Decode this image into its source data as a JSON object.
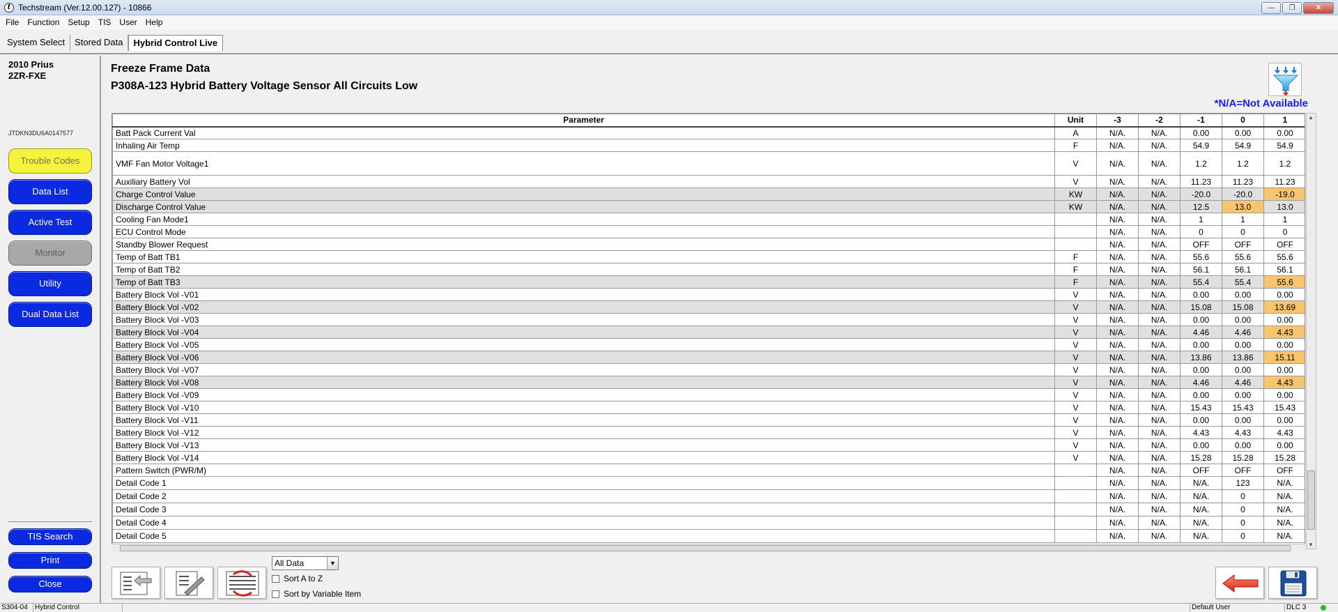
{
  "window": {
    "title": "Techstream (Ver.12.00.127) - 10866",
    "app_icon": "t",
    "minimize": "—",
    "maximize": "❐",
    "close": "✕"
  },
  "menu": [
    "File",
    "Function",
    "Setup",
    "TIS",
    "User",
    "Help"
  ],
  "tabs": [
    "System Select",
    "Stored Data",
    "Hybrid Control Live"
  ],
  "left_panel": {
    "vehicle_line1": "2010 Prius",
    "vehicle_line2": "2ZR-FXE",
    "vin": "JTDKN3DU6A0147577",
    "buttons": [
      "Trouble Codes",
      "Data List",
      "Active Test",
      "Monitor",
      "Utility",
      "Dual Data List"
    ],
    "bottom_buttons": [
      "TIS Search",
      "Print",
      "Close"
    ]
  },
  "main": {
    "title": "Freeze Frame Data",
    "dtc": "P308A-123 Hybrid Battery Voltage Sensor All Circuits Low",
    "na_note": "*N/A=Not Available"
  },
  "table": {
    "headers": [
      "Parameter",
      "Unit",
      "-3",
      "-2",
      "-1",
      "0",
      "1"
    ],
    "rows": [
      {
        "p": "Batt Pack Current Val",
        "u": "A",
        "v": [
          "N/A.",
          "N/A.",
          "0.00",
          "0.00",
          "0.00"
        ],
        "h": []
      },
      {
        "p": "Inhaling Air Temp",
        "u": "F",
        "v": [
          "N/A.",
          "N/A.",
          "54.9",
          "54.9",
          "54.9"
        ],
        "h": []
      },
      {
        "p": "VMF Fan Motor Voltage1",
        "u": "V",
        "v": [
          "N/A.",
          "N/A.",
          "1.2",
          "1.2",
          "1.2"
        ],
        "h": [],
        "tall": true
      },
      {
        "p": "Auxiliary Battery Vol",
        "u": "V",
        "v": [
          "N/A.",
          "N/A.",
          "11.23",
          "11.23",
          "11.23"
        ],
        "h": []
      },
      {
        "p": "Charge Control Value",
        "u": "KW",
        "v": [
          "N/A.",
          "N/A.",
          "-20.0",
          "-20.0",
          "-19.0"
        ],
        "h": [
          4
        ],
        "shaded": true
      },
      {
        "p": "Discharge Control Value",
        "u": "KW",
        "v": [
          "N/A.",
          "N/A.",
          "12.5",
          "13.0",
          "13.0"
        ],
        "h": [
          3
        ],
        "shaded": true
      },
      {
        "p": "Cooling Fan Mode1",
        "u": "",
        "v": [
          "N/A.",
          "N/A.",
          "1",
          "1",
          "1"
        ],
        "h": []
      },
      {
        "p": "ECU Control Mode",
        "u": "",
        "v": [
          "N/A.",
          "N/A.",
          "0",
          "0",
          "0"
        ],
        "h": []
      },
      {
        "p": "Standby Blower Request",
        "u": "",
        "v": [
          "N/A.",
          "N/A.",
          "OFF",
          "OFF",
          "OFF"
        ],
        "h": []
      },
      {
        "p": "Temp of Batt TB1",
        "u": "F",
        "v": [
          "N/A.",
          "N/A.",
          "55.6",
          "55.6",
          "55.6"
        ],
        "h": []
      },
      {
        "p": "Temp of Batt TB2",
        "u": "F",
        "v": [
          "N/A.",
          "N/A.",
          "56.1",
          "56.1",
          "56.1"
        ],
        "h": []
      },
      {
        "p": "Temp of Batt TB3",
        "u": "F",
        "v": [
          "N/A.",
          "N/A.",
          "55.4",
          "55.4",
          "55.6"
        ],
        "h": [
          4
        ],
        "shaded": true
      },
      {
        "p": "Battery Block Vol -V01",
        "u": "V",
        "v": [
          "N/A.",
          "N/A.",
          "0.00",
          "0.00",
          "0.00"
        ],
        "h": []
      },
      {
        "p": "Battery Block Vol -V02",
        "u": "V",
        "v": [
          "N/A.",
          "N/A.",
          "15.08",
          "15.08",
          "13.69"
        ],
        "h": [
          4
        ],
        "shaded": true
      },
      {
        "p": "Battery Block Vol -V03",
        "u": "V",
        "v": [
          "N/A.",
          "N/A.",
          "0.00",
          "0.00",
          "0.00"
        ],
        "h": []
      },
      {
        "p": "Battery Block Vol -V04",
        "u": "V",
        "v": [
          "N/A.",
          "N/A.",
          "4.46",
          "4.46",
          "4.43"
        ],
        "h": [
          4
        ],
        "shaded": true
      },
      {
        "p": "Battery Block Vol -V05",
        "u": "V",
        "v": [
          "N/A.",
          "N/A.",
          "0.00",
          "0.00",
          "0.00"
        ],
        "h": []
      },
      {
        "p": "Battery Block Vol -V06",
        "u": "V",
        "v": [
          "N/A.",
          "N/A.",
          "13.86",
          "13.86",
          "15.11"
        ],
        "h": [
          4
        ],
        "shaded": true
      },
      {
        "p": "Battery Block Vol -V07",
        "u": "V",
        "v": [
          "N/A.",
          "N/A.",
          "0.00",
          "0.00",
          "0.00"
        ],
        "h": []
      },
      {
        "p": "Battery Block Vol -V08",
        "u": "V",
        "v": [
          "N/A.",
          "N/A.",
          "4.46",
          "4.46",
          "4.43"
        ],
        "h": [
          4
        ],
        "shaded": true
      },
      {
        "p": "Battery Block Vol -V09",
        "u": "V",
        "v": [
          "N/A.",
          "N/A.",
          "0.00",
          "0.00",
          "0.00"
        ],
        "h": []
      },
      {
        "p": "Battery Block Vol -V10",
        "u": "V",
        "v": [
          "N/A.",
          "N/A.",
          "15.43",
          "15.43",
          "15.43"
        ],
        "h": []
      },
      {
        "p": "Battery Block Vol -V11",
        "u": "V",
        "v": [
          "N/A.",
          "N/A.",
          "0.00",
          "0.00",
          "0.00"
        ],
        "h": []
      },
      {
        "p": "Battery Block Vol -V12",
        "u": "V",
        "v": [
          "N/A.",
          "N/A.",
          "4.43",
          "4.43",
          "4.43"
        ],
        "h": []
      },
      {
        "p": "Battery Block Vol -V13",
        "u": "V",
        "v": [
          "N/A.",
          "N/A.",
          "0.00",
          "0.00",
          "0.00"
        ],
        "h": []
      },
      {
        "p": "Battery Block Vol -V14",
        "u": "V",
        "v": [
          "N/A.",
          "N/A.",
          "15.28",
          "15.28",
          "15.28"
        ],
        "h": []
      },
      {
        "p": "Pattern Switch (PWR/M)",
        "u": "",
        "v": [
          "N/A.",
          "N/A.",
          "OFF",
          "OFF",
          "OFF"
        ],
        "h": []
      },
      {
        "p": "Detail Code 1",
        "u": "",
        "v": [
          "N/A.",
          "N/A.",
          "N/A.",
          "123",
          "N/A."
        ],
        "h": [],
        "mid": true
      },
      {
        "p": "Detail Code 2",
        "u": "",
        "v": [
          "N/A.",
          "N/A.",
          "N/A.",
          "0",
          "N/A."
        ],
        "h": [],
        "mid": true
      },
      {
        "p": "Detail Code 3",
        "u": "",
        "v": [
          "N/A.",
          "N/A.",
          "N/A.",
          "0",
          "N/A."
        ],
        "h": [],
        "mid": true
      },
      {
        "p": "Detail Code 4",
        "u": "",
        "v": [
          "N/A.",
          "N/A.",
          "N/A.",
          "0",
          "N/A."
        ],
        "h": [],
        "mid": true
      },
      {
        "p": "Detail Code 5",
        "u": "",
        "v": [
          "N/A.",
          "N/A.",
          "N/A.",
          "0",
          "N/A."
        ],
        "h": [],
        "mid": true
      }
    ]
  },
  "toolbar": {
    "view_select": "All Data",
    "sort_az": "Sort A to Z",
    "sort_variable": "Sort by Variable Item"
  },
  "status_bar": {
    "code": "S304-04",
    "system": "Hybrid Control",
    "user": "Default User",
    "connector": "DLC 3"
  },
  "colors": {
    "nav_blue": "#0b29e0",
    "trouble_yellow": "#f5f33b",
    "highlight_orange": "#f8c56c",
    "na_blue": "#1a1aff"
  }
}
